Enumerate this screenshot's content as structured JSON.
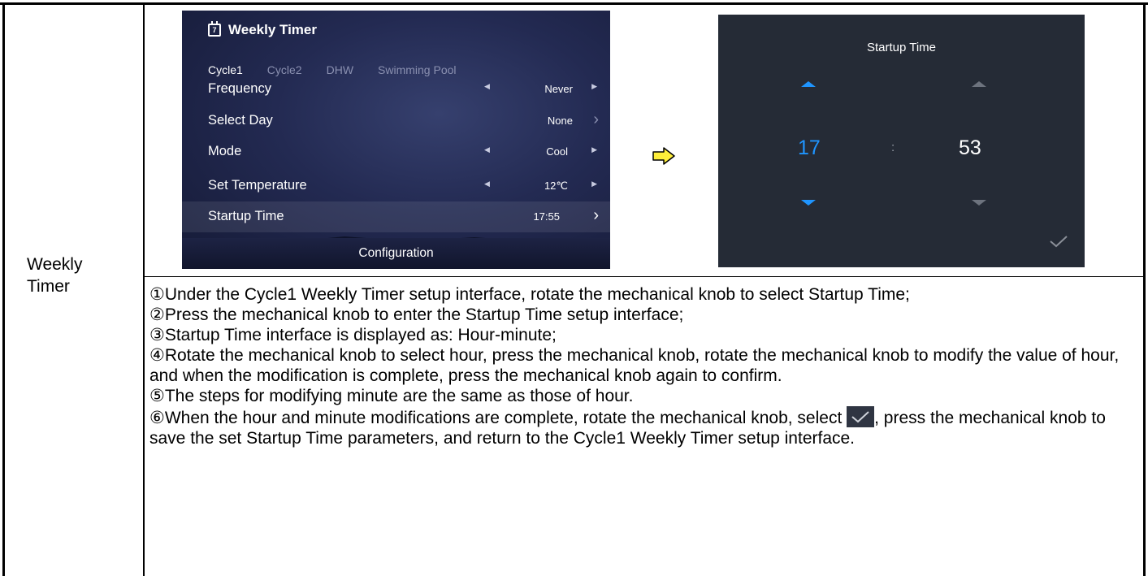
{
  "row_label": "Weekly\nTimer",
  "screen1": {
    "title": "Weekly Timer",
    "calendar_icon_text": "7",
    "tabs": [
      "Cycle1",
      "Cycle2",
      "DHW",
      "Swimming Pool"
    ],
    "rows": [
      {
        "label": "Frequency",
        "value": "Never",
        "type": "toggle"
      },
      {
        "label": "Select Day",
        "value": "None",
        "type": "link"
      },
      {
        "label": "Mode",
        "value": "Cool",
        "type": "toggle"
      },
      {
        "label": "Set Temperature",
        "value": "12℃",
        "type": "toggle"
      },
      {
        "label": "Startup Time",
        "value": "17:55",
        "type": "link",
        "selected": true
      }
    ],
    "config_button": "Configuration"
  },
  "screen2": {
    "title": "Startup Time",
    "hour": "17",
    "separator": ":",
    "minute": "53",
    "accent_color": "#1f95ff"
  },
  "instructions": [
    "①Under the Cycle1 Weekly Timer setup interface, rotate the mechanical knob to select Startup Time;",
    "②Press the mechanical knob to enter the Startup Time setup interface;",
    "③Startup Time interface is displayed as: Hour-minute;",
    "④Rotate the mechanical knob to select hour, press the mechanical knob, rotate the mechanical knob to modify the value of hour, and when the modification is complete, press the mechanical knob again to confirm.",
    "⑤The steps for modifying minute are the same as those of hour."
  ],
  "instruction6": {
    "before": "⑥When the hour and minute modifications are complete, rotate the mechanical knob, select ",
    "after": ", press the mechanical knob to save the set Startup Time parameters, and return to the Cycle1 Weekly Timer setup interface."
  }
}
